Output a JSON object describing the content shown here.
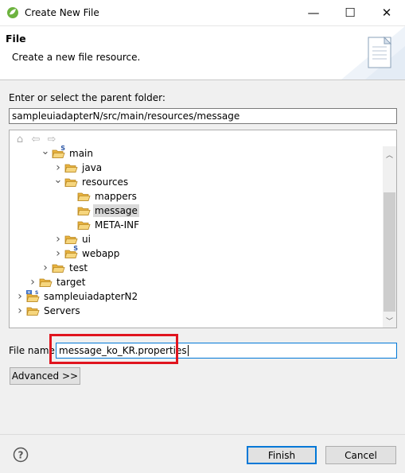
{
  "window": {
    "title": "Create New File",
    "minimize_glyph": "—",
    "maximize_glyph": "☐",
    "close_glyph": "✕"
  },
  "header": {
    "title": "File",
    "description": "Create a new file resource."
  },
  "parent_folder": {
    "label": "Enter or select the parent folder:",
    "value": "sampleuiadapterN/src/main/resources/message"
  },
  "tree": {
    "items": [
      {
        "label": "main",
        "icon": "source-folder-icon",
        "expanded": true
      },
      {
        "label": "java",
        "icon": "folder-icon",
        "expanded": false
      },
      {
        "label": "resources",
        "icon": "folder-icon",
        "expanded": true
      },
      {
        "label": "mappers",
        "icon": "folder-icon"
      },
      {
        "label": "message",
        "icon": "folder-icon",
        "selected": true
      },
      {
        "label": "META-INF",
        "icon": "folder-icon"
      },
      {
        "label": "ui",
        "icon": "folder-icon",
        "expanded": false
      },
      {
        "label": "webapp",
        "icon": "source-folder-icon",
        "expanded": false
      },
      {
        "label": "test",
        "icon": "folder-icon",
        "expanded": false
      },
      {
        "label": "target",
        "icon": "folder-icon",
        "expanded": false
      },
      {
        "label": "sampleuiadapterN2",
        "icon": "project-icon",
        "expanded": false
      },
      {
        "label": "Servers",
        "icon": "folder-icon",
        "expanded": false
      }
    ]
  },
  "file_name": {
    "label": "File name:",
    "value": "message_ko_KR.properties"
  },
  "buttons": {
    "advanced": "Advanced >>",
    "finish": "Finish",
    "cancel": "Cancel"
  },
  "colors": {
    "highlight": "#e0141e",
    "folder": "#f2c45a",
    "accent": "#0078d7"
  }
}
